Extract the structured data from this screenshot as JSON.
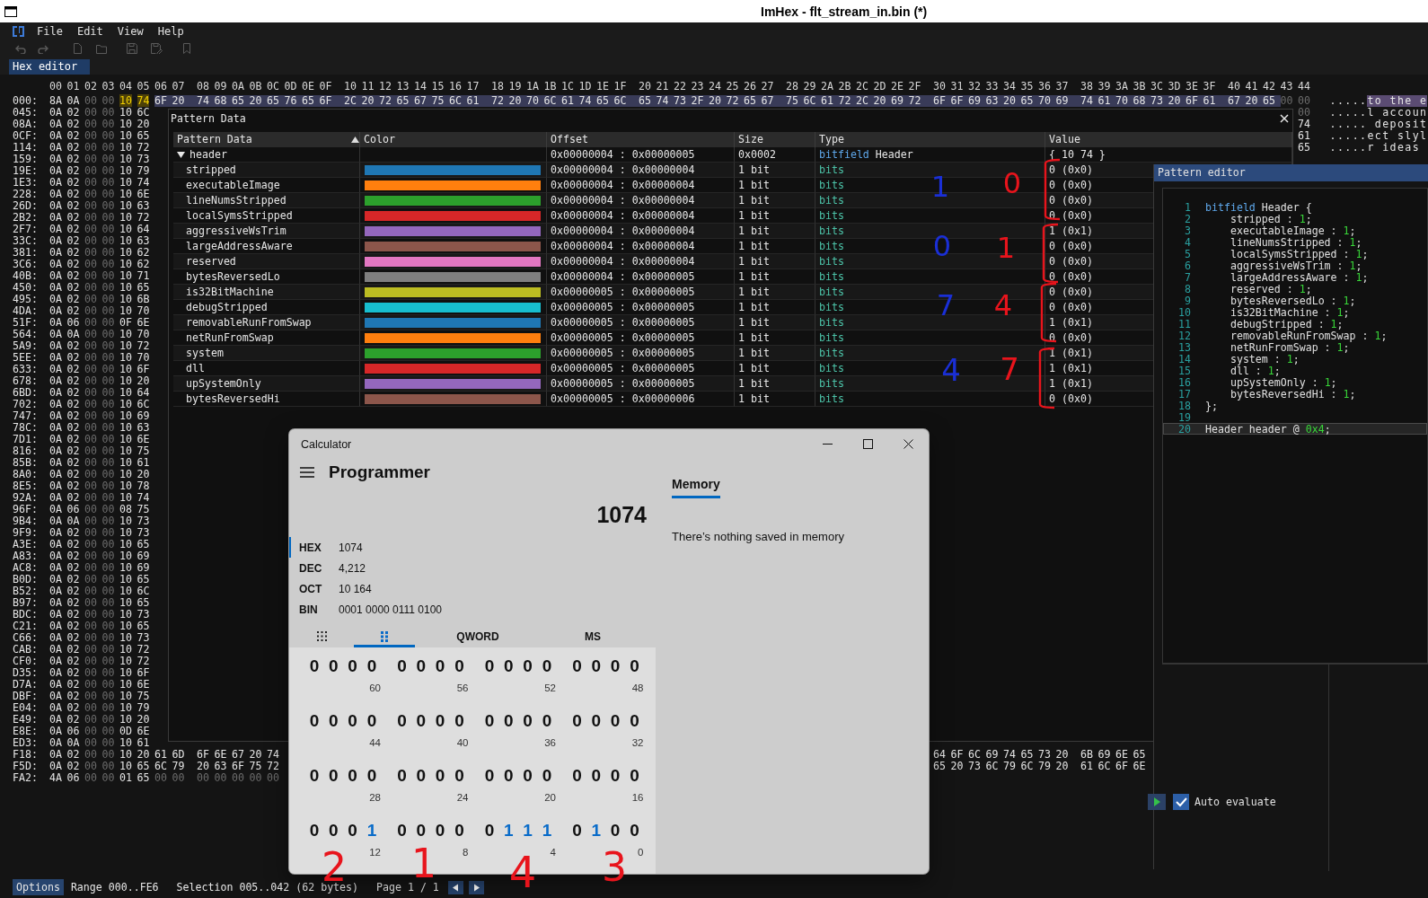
{
  "window": {
    "title": "ImHex - flt_stream_in.bin (*)"
  },
  "menu": [
    {
      "label": "File"
    },
    {
      "label": "Edit"
    },
    {
      "label": "View"
    },
    {
      "label": "Help"
    }
  ],
  "toolbar": [
    {
      "kind": "undo",
      "disabled": true
    },
    {
      "kind": "redo",
      "disabled": true
    },
    {
      "kind": "new-file",
      "disabled": true
    },
    {
      "kind": "open",
      "disabled": true
    },
    {
      "kind": "save",
      "disabled": true
    },
    {
      "kind": "save-as",
      "disabled": true
    },
    {
      "kind": "bookmark",
      "disabled": true
    }
  ],
  "tabs": [
    {
      "label": "Hex editor",
      "selected": true
    }
  ],
  "hex_view": {
    "columns": [
      "00",
      "01",
      "02",
      "03",
      "04",
      "05",
      "06",
      "07",
      "08",
      "09",
      "0A",
      "0B",
      "0C",
      "0D",
      "0E",
      "0F",
      "10",
      "11",
      "12",
      "13",
      "14",
      "15",
      "16",
      "17",
      "18",
      "19",
      "1A",
      "1B",
      "1C",
      "1D",
      "1E",
      "1F",
      "20",
      "21",
      "22",
      "23",
      "24",
      "25",
      "26",
      "27",
      "28",
      "29",
      "2A",
      "2B",
      "2C",
      "2D",
      "2E",
      "2F",
      "30",
      "31",
      "32",
      "33",
      "34",
      "35",
      "36",
      "37",
      "38",
      "39",
      "3A",
      "3B",
      "3C",
      "3D",
      "3E",
      "3F",
      "40",
      "41",
      "42",
      "43",
      "44"
    ],
    "rows": [
      {
        "offset": "000:",
        "bytes": [
          "8A",
          "0A",
          "00",
          "00"
        ],
        "pattern_bytes": [
          "10",
          "74"
        ],
        "selected_bytes": [
          "6F",
          "20",
          "74",
          "68",
          "65",
          "20",
          "65",
          "76",
          "65",
          "6F",
          "2C",
          "20",
          "72",
          "65",
          "67",
          "75",
          "6C",
          "61",
          "72",
          "20",
          "70",
          "6C",
          "61",
          "74",
          "65",
          "6C",
          "65",
          "74",
          "73",
          "2F",
          "20",
          "72",
          "65",
          "67",
          "75",
          "6C",
          "61",
          "72",
          "2C",
          "20",
          "69",
          "72",
          "6F",
          "6F",
          "69",
          "63",
          "20",
          "65",
          "70",
          "69",
          "74",
          "61",
          "70",
          "68",
          "73",
          "20",
          "6F",
          "61",
          "67",
          "20",
          "65"
        ],
        "end_bytes": [
          "00",
          "00"
        ],
        "ascii": ".....",
        "ascii_selected": "to the e"
      },
      {
        "offset": "045:",
        "bytes": [
          "0A",
          "02",
          "00",
          "00",
          "10",
          "6C"
        ],
        "end_bytes": [
          "00"
        ],
        "ascii": ".....l accoun"
      },
      {
        "offset": "08A:",
        "bytes": [
          "0A",
          "02",
          "00",
          "00",
          "10",
          "20"
        ],
        "end_bytes": [
          "74"
        ],
        "ascii": "..... deposit"
      },
      {
        "offset": "0CF:",
        "bytes": [
          "0A",
          "02",
          "00",
          "00",
          "10",
          "65"
        ],
        "end_bytes": [
          "61"
        ],
        "ascii": ".....ect slyl"
      },
      {
        "offset": "114:",
        "bytes": [
          "0A",
          "02",
          "00",
          "00",
          "10",
          "72"
        ],
        "end_bytes": [
          "65"
        ],
        "ascii": ".....r ideas"
      },
      {
        "offset": "159:",
        "bytes": [
          "0A",
          "02",
          "00",
          "00",
          "10",
          "73"
        ]
      },
      {
        "offset": "19E:",
        "bytes": [
          "0A",
          "02",
          "00",
          "00",
          "10",
          "79"
        ]
      },
      {
        "offset": "1E3:",
        "bytes": [
          "0A",
          "02",
          "00",
          "00",
          "10",
          "74"
        ]
      },
      {
        "offset": "228:",
        "bytes": [
          "0A",
          "02",
          "00",
          "00",
          "10",
          "6E"
        ]
      },
      {
        "offset": "26D:",
        "bytes": [
          "0A",
          "02",
          "00",
          "00",
          "10",
          "63"
        ]
      },
      {
        "offset": "2B2:",
        "bytes": [
          "0A",
          "02",
          "00",
          "00",
          "10",
          "72"
        ]
      },
      {
        "offset": "2F7:",
        "bytes": [
          "0A",
          "02",
          "00",
          "00",
          "10",
          "64"
        ]
      },
      {
        "offset": "33C:",
        "bytes": [
          "0A",
          "02",
          "00",
          "00",
          "10",
          "63"
        ]
      },
      {
        "offset": "381:",
        "bytes": [
          "0A",
          "02",
          "00",
          "00",
          "10",
          "62"
        ]
      },
      {
        "offset": "3C6:",
        "bytes": [
          "0A",
          "02",
          "00",
          "00",
          "10",
          "62"
        ]
      },
      {
        "offset": "40B:",
        "bytes": [
          "0A",
          "02",
          "00",
          "00",
          "10",
          "71"
        ]
      },
      {
        "offset": "450:",
        "bytes": [
          "0A",
          "02",
          "00",
          "00",
          "10",
          "65"
        ]
      },
      {
        "offset": "495:",
        "bytes": [
          "0A",
          "02",
          "00",
          "00",
          "10",
          "6B"
        ]
      },
      {
        "offset": "4DA:",
        "bytes": [
          "0A",
          "02",
          "00",
          "00",
          "10",
          "70"
        ]
      },
      {
        "offset": "51F:",
        "bytes": [
          "0A",
          "06",
          "00",
          "00",
          "0F",
          "6E"
        ]
      },
      {
        "offset": "564:",
        "bytes": [
          "0A",
          "0A",
          "00",
          "00",
          "10",
          "70"
        ]
      },
      {
        "offset": "5A9:",
        "bytes": [
          "0A",
          "02",
          "00",
          "00",
          "10",
          "72"
        ]
      },
      {
        "offset": "5EE:",
        "bytes": [
          "0A",
          "02",
          "00",
          "00",
          "10",
          "70"
        ]
      },
      {
        "offset": "633:",
        "bytes": [
          "0A",
          "02",
          "00",
          "00",
          "10",
          "6F"
        ]
      },
      {
        "offset": "678:",
        "bytes": [
          "0A",
          "02",
          "00",
          "00",
          "10",
          "20"
        ]
      },
      {
        "offset": "6BD:",
        "bytes": [
          "0A",
          "02",
          "00",
          "00",
          "10",
          "64"
        ]
      },
      {
        "offset": "702:",
        "bytes": [
          "0A",
          "02",
          "00",
          "00",
          "10",
          "6C"
        ]
      },
      {
        "offset": "747:",
        "bytes": [
          "0A",
          "02",
          "00",
          "00",
          "10",
          "69"
        ]
      },
      {
        "offset": "78C:",
        "bytes": [
          "0A",
          "02",
          "00",
          "00",
          "10",
          "63"
        ]
      },
      {
        "offset": "7D1:",
        "bytes": [
          "0A",
          "02",
          "00",
          "00",
          "10",
          "6E"
        ]
      },
      {
        "offset": "816:",
        "bytes": [
          "0A",
          "02",
          "00",
          "00",
          "10",
          "75"
        ]
      },
      {
        "offset": "85B:",
        "bytes": [
          "0A",
          "02",
          "00",
          "00",
          "10",
          "61"
        ]
      },
      {
        "offset": "8A0:",
        "bytes": [
          "0A",
          "02",
          "00",
          "00",
          "10",
          "20"
        ]
      },
      {
        "offset": "8E5:",
        "bytes": [
          "0A",
          "02",
          "00",
          "00",
          "10",
          "78"
        ]
      },
      {
        "offset": "92A:",
        "bytes": [
          "0A",
          "02",
          "00",
          "00",
          "10",
          "74"
        ]
      },
      {
        "offset": "96F:",
        "bytes": [
          "0A",
          "06",
          "00",
          "00",
          "08",
          "75"
        ]
      },
      {
        "offset": "9B4:",
        "bytes": [
          "0A",
          "0A",
          "00",
          "00",
          "10",
          "73"
        ]
      },
      {
        "offset": "9F9:",
        "bytes": [
          "0A",
          "02",
          "00",
          "00",
          "10",
          "73"
        ]
      },
      {
        "offset": "A3E:",
        "bytes": [
          "0A",
          "02",
          "00",
          "00",
          "10",
          "65"
        ]
      },
      {
        "offset": "A83:",
        "bytes": [
          "0A",
          "02",
          "00",
          "00",
          "10",
          "69"
        ]
      },
      {
        "offset": "AC8:",
        "bytes": [
          "0A",
          "02",
          "00",
          "00",
          "10",
          "69"
        ]
      },
      {
        "offset": "B0D:",
        "bytes": [
          "0A",
          "02",
          "00",
          "00",
          "10",
          "65"
        ]
      },
      {
        "offset": "B52:",
        "bytes": [
          "0A",
          "02",
          "00",
          "00",
          "10",
          "6C"
        ]
      },
      {
        "offset": "B97:",
        "bytes": [
          "0A",
          "02",
          "00",
          "00",
          "10",
          "65"
        ]
      },
      {
        "offset": "BDC:",
        "bytes": [
          "0A",
          "02",
          "00",
          "00",
          "10",
          "73"
        ]
      },
      {
        "offset": "C21:",
        "bytes": [
          "0A",
          "02",
          "00",
          "00",
          "10",
          "65"
        ]
      },
      {
        "offset": "C66:",
        "bytes": [
          "0A",
          "02",
          "00",
          "00",
          "10",
          "73"
        ]
      },
      {
        "offset": "CAB:",
        "bytes": [
          "0A",
          "02",
          "00",
          "00",
          "10",
          "72"
        ]
      },
      {
        "offset": "CF0:",
        "bytes": [
          "0A",
          "02",
          "00",
          "00",
          "10",
          "72"
        ]
      },
      {
        "offset": "D35:",
        "bytes": [
          "0A",
          "02",
          "00",
          "00",
          "10",
          "6F"
        ]
      },
      {
        "offset": "D7A:",
        "bytes": [
          "0A",
          "02",
          "00",
          "00",
          "10",
          "6E"
        ]
      },
      {
        "offset": "DBF:",
        "bytes": [
          "0A",
          "02",
          "00",
          "00",
          "10",
          "75"
        ]
      },
      {
        "offset": "E04:",
        "bytes": [
          "0A",
          "02",
          "00",
          "00",
          "10",
          "79"
        ]
      },
      {
        "offset": "E49:",
        "bytes": [
          "0A",
          "02",
          "00",
          "00",
          "10",
          "20"
        ]
      },
      {
        "offset": "E8E:",
        "bytes": [
          "0A",
          "06",
          "00",
          "00",
          "0D",
          "6E"
        ]
      },
      {
        "offset": "ED3:",
        "bytes": [
          "0A",
          "0A",
          "00",
          "00",
          "10",
          "61"
        ]
      },
      {
        "offset": "F18:",
        "bytes": [
          "0A",
          "02",
          "00",
          "00",
          "10",
          "20",
          "61",
          "6D",
          "6F",
          "6E",
          "67",
          "20",
          "74"
        ],
        "far_bytes": [
          "64",
          "6F",
          "6C",
          "69",
          "74",
          "65",
          "73",
          "20",
          "6B",
          "69",
          "6E",
          "65"
        ]
      },
      {
        "offset": "F5D:",
        "bytes": [
          "0A",
          "02",
          "00",
          "00",
          "10",
          "65",
          "6C",
          "79",
          "20",
          "63",
          "6F",
          "75",
          "72"
        ],
        "far_bytes": [
          "65",
          "20",
          "73",
          "6C",
          "79",
          "6C",
          "79",
          "20",
          "61",
          "6C",
          "6F",
          "6E"
        ]
      },
      {
        "offset": "FA2:",
        "bytes": [
          "4A",
          "06",
          "00",
          "00",
          "01",
          "65",
          "00",
          "00",
          "00",
          "00",
          "00",
          "00",
          "00"
        ]
      }
    ]
  },
  "pattern_data": {
    "title": "Pattern Data",
    "columns": [
      "Pattern Data",
      "Color",
      "Offset",
      "Size",
      "Type",
      "Value"
    ],
    "rows": [
      {
        "name": "header",
        "expanded": true,
        "offset": "0x00000004 : 0x00000005",
        "size": "0x0002",
        "kind": "bitfield",
        "type_keyword": "bitfield",
        "type": "Header",
        "value": "{ 10 74 }",
        "children": [
          {
            "name": "stripped",
            "color": "#1f77b4",
            "offset": "0x00000004 : 0x00000004",
            "size": "1 bit",
            "kind": "bits",
            "type_keyword": "bits",
            "value": "0 (0x0)"
          },
          {
            "name": "executableImage",
            "color": "#ff7f0e",
            "offset": "0x00000004 : 0x00000004",
            "size": "1 bit",
            "kind": "bits",
            "type_keyword": "bits",
            "value": "0 (0x0)"
          },
          {
            "name": "lineNumsStripped",
            "color": "#2ca02c",
            "offset": "0x00000004 : 0x00000004",
            "size": "1 bit",
            "kind": "bits",
            "type_keyword": "bits",
            "value": "0 (0x0)"
          },
          {
            "name": "localSymsStripped",
            "color": "#d62728",
            "offset": "0x00000004 : 0x00000004",
            "size": "1 bit",
            "kind": "bits",
            "type_keyword": "bits",
            "value": "0 (0x0)"
          },
          {
            "name": "aggressiveWsTrim",
            "color": "#9467bd",
            "offset": "0x00000004 : 0x00000004",
            "size": "1 bit",
            "kind": "bits",
            "type_keyword": "bits",
            "value": "1 (0x1)"
          },
          {
            "name": "largeAddressAware",
            "color": "#8c564b",
            "offset": "0x00000004 : 0x00000004",
            "size": "1 bit",
            "kind": "bits",
            "type_keyword": "bits",
            "value": "0 (0x0)"
          },
          {
            "name": "reserved",
            "color": "#e377c2",
            "offset": "0x00000004 : 0x00000004",
            "size": "1 bit",
            "kind": "bits",
            "type_keyword": "bits",
            "value": "0 (0x0)"
          },
          {
            "name": "bytesReversedLo",
            "color": "#7f7f7f",
            "offset": "0x00000004 : 0x00000005",
            "size": "1 bit",
            "kind": "bits",
            "type_keyword": "bits",
            "value": "0 (0x0)"
          },
          {
            "name": "is32BitMachine",
            "color": "#bcbd22",
            "offset": "0x00000005 : 0x00000005",
            "size": "1 bit",
            "kind": "bits",
            "type_keyword": "bits",
            "value": "0 (0x0)"
          },
          {
            "name": "debugStripped",
            "color": "#17becf",
            "offset": "0x00000005 : 0x00000005",
            "size": "1 bit",
            "kind": "bits",
            "type_keyword": "bits",
            "value": "0 (0x0)"
          },
          {
            "name": "removableRunFromSwap",
            "color": "#1f77b4",
            "offset": "0x00000005 : 0x00000005",
            "size": "1 bit",
            "kind": "bits",
            "type_keyword": "bits",
            "value": "1 (0x1)"
          },
          {
            "name": "netRunFromSwap",
            "color": "#ff7f0e",
            "offset": "0x00000005 : 0x00000005",
            "size": "1 bit",
            "kind": "bits",
            "type_keyword": "bits",
            "value": "0 (0x0)"
          },
          {
            "name": "system",
            "color": "#2ca02c",
            "offset": "0x00000005 : 0x00000005",
            "size": "1 bit",
            "kind": "bits",
            "type_keyword": "bits",
            "value": "1 (0x1)"
          },
          {
            "name": "dll",
            "color": "#d62728",
            "offset": "0x00000005 : 0x00000005",
            "size": "1 bit",
            "kind": "bits",
            "type_keyword": "bits",
            "value": "1 (0x1)"
          },
          {
            "name": "upSystemOnly",
            "color": "#9467bd",
            "offset": "0x00000005 : 0x00000005",
            "size": "1 bit",
            "kind": "bits",
            "type_keyword": "bits",
            "value": "1 (0x1)"
          },
          {
            "name": "bytesReversedHi",
            "color": "#8c564b",
            "offset": "0x00000005 : 0x00000006",
            "size": "1 bit",
            "kind": "bits",
            "type_keyword": "bits",
            "value": "0 (0x0)"
          }
        ]
      }
    ]
  },
  "pattern_editor": {
    "title": "Pattern editor",
    "lines": [
      {
        "number": "1",
        "current": false,
        "tokens": [
          {
            "kind": "keyword",
            "text": "bitfield"
          },
          {
            "kind": "plain",
            "text": " Header {"
          }
        ]
      },
      {
        "number": "2",
        "current": false,
        "tokens": [
          {
            "kind": "plain",
            "text": "    stripped : "
          },
          {
            "kind": "number",
            "text": "1"
          },
          {
            "kind": "plain",
            "text": ";"
          }
        ]
      },
      {
        "number": "3",
        "current": false,
        "tokens": [
          {
            "kind": "plain",
            "text": "    executableImage : "
          },
          {
            "kind": "number",
            "text": "1"
          },
          {
            "kind": "plain",
            "text": ";"
          }
        ]
      },
      {
        "number": "4",
        "current": false,
        "tokens": [
          {
            "kind": "plain",
            "text": "    lineNumsStripped : "
          },
          {
            "kind": "number",
            "text": "1"
          },
          {
            "kind": "plain",
            "text": ";"
          }
        ]
      },
      {
        "number": "5",
        "current": false,
        "tokens": [
          {
            "kind": "plain",
            "text": "    localSymsStripped : "
          },
          {
            "kind": "number",
            "text": "1"
          },
          {
            "kind": "plain",
            "text": ";"
          }
        ]
      },
      {
        "number": "6",
        "current": false,
        "tokens": [
          {
            "kind": "plain",
            "text": "    aggressiveWsTrim : "
          },
          {
            "kind": "number",
            "text": "1"
          },
          {
            "kind": "plain",
            "text": ";"
          }
        ]
      },
      {
        "number": "7",
        "current": false,
        "tokens": [
          {
            "kind": "plain",
            "text": "    largeAddressAware : "
          },
          {
            "kind": "number",
            "text": "1"
          },
          {
            "kind": "plain",
            "text": ";"
          }
        ]
      },
      {
        "number": "8",
        "current": false,
        "tokens": [
          {
            "kind": "plain",
            "text": "    reserved : "
          },
          {
            "kind": "number",
            "text": "1"
          },
          {
            "kind": "plain",
            "text": ";"
          }
        ]
      },
      {
        "number": "9",
        "current": false,
        "tokens": [
          {
            "kind": "plain",
            "text": "    bytesReversedLo : "
          },
          {
            "kind": "number",
            "text": "1"
          },
          {
            "kind": "plain",
            "text": ";"
          }
        ]
      },
      {
        "number": "10",
        "current": false,
        "tokens": [
          {
            "kind": "plain",
            "text": "    is32BitMachine : "
          },
          {
            "kind": "number",
            "text": "1"
          },
          {
            "kind": "plain",
            "text": ";"
          }
        ]
      },
      {
        "number": "11",
        "current": false,
        "tokens": [
          {
            "kind": "plain",
            "text": "    debugStripped : "
          },
          {
            "kind": "number",
            "text": "1"
          },
          {
            "kind": "plain",
            "text": ";"
          }
        ]
      },
      {
        "number": "12",
        "current": false,
        "tokens": [
          {
            "kind": "plain",
            "text": "    removableRunFromSwap : "
          },
          {
            "kind": "number",
            "text": "1"
          },
          {
            "kind": "plain",
            "text": ";"
          }
        ]
      },
      {
        "number": "13",
        "current": false,
        "tokens": [
          {
            "kind": "plain",
            "text": "    netRunFromSwap : "
          },
          {
            "kind": "number",
            "text": "1"
          },
          {
            "kind": "plain",
            "text": ";"
          }
        ]
      },
      {
        "number": "14",
        "current": false,
        "tokens": [
          {
            "kind": "plain",
            "text": "    system : "
          },
          {
            "kind": "number",
            "text": "1"
          },
          {
            "kind": "plain",
            "text": ";"
          }
        ]
      },
      {
        "number": "15",
        "current": false,
        "tokens": [
          {
            "kind": "plain",
            "text": "    dll : "
          },
          {
            "kind": "number",
            "text": "1"
          },
          {
            "kind": "plain",
            "text": ";"
          }
        ]
      },
      {
        "number": "16",
        "current": false,
        "tokens": [
          {
            "kind": "plain",
            "text": "    upSystemOnly : "
          },
          {
            "kind": "number",
            "text": "1"
          },
          {
            "kind": "plain",
            "text": ";"
          }
        ]
      },
      {
        "number": "17",
        "current": false,
        "tokens": [
          {
            "kind": "plain",
            "text": "    bytesReversedHi : "
          },
          {
            "kind": "number",
            "text": "1"
          },
          {
            "kind": "plain",
            "text": ";"
          }
        ]
      },
      {
        "number": "18",
        "current": false,
        "tokens": [
          {
            "kind": "plain",
            "text": "};"
          }
        ]
      },
      {
        "number": "19",
        "current": false
      },
      {
        "number": "20",
        "current": true,
        "tokens": [
          {
            "kind": "plain",
            "text": "Header header @ "
          },
          {
            "kind": "number",
            "text": "0x4"
          },
          {
            "kind": "plain",
            "text": ";"
          }
        ]
      }
    ],
    "auto_evaluate": {
      "label": "Auto evaluate",
      "checked": true
    }
  },
  "calculator": {
    "title": "Calculator",
    "mode": "Programmer",
    "display": "1074",
    "radixes": [
      {
        "label": "HEX",
        "value": "1074",
        "selected": true
      },
      {
        "label": "DEC",
        "value": "4,212",
        "selected": false
      },
      {
        "label": "OCT",
        "value": "10 164",
        "selected": false
      },
      {
        "label": "BIN",
        "value": "0001 0000 0111 0100",
        "selected": false
      }
    ],
    "keypad_tabs": [
      {
        "kind": "keypad",
        "selected": false
      },
      {
        "kind": "bit-toggle",
        "selected": true
      },
      {
        "kind": "text",
        "label": "QWORD",
        "selected": false
      },
      {
        "kind": "text",
        "label": "MS",
        "selected": false
      }
    ],
    "bit_rows": [
      {
        "groups": [
          {
            "bits": [
              "0",
              "0",
              "0",
              "0"
            ],
            "set": [
              false,
              false,
              false,
              false
            ],
            "label": "60"
          },
          {
            "bits": [
              "0",
              "0",
              "0",
              "0"
            ],
            "set": [
              false,
              false,
              false,
              false
            ],
            "label": "56"
          },
          {
            "bits": [
              "0",
              "0",
              "0",
              "0"
            ],
            "set": [
              false,
              false,
              false,
              false
            ],
            "label": "52"
          },
          {
            "bits": [
              "0",
              "0",
              "0",
              "0"
            ],
            "set": [
              false,
              false,
              false,
              false
            ],
            "label": "48"
          }
        ]
      },
      {
        "groups": [
          {
            "bits": [
              "0",
              "0",
              "0",
              "0"
            ],
            "set": [
              false,
              false,
              false,
              false
            ],
            "label": "44"
          },
          {
            "bits": [
              "0",
              "0",
              "0",
              "0"
            ],
            "set": [
              false,
              false,
              false,
              false
            ],
            "label": "40"
          },
          {
            "bits": [
              "0",
              "0",
              "0",
              "0"
            ],
            "set": [
              false,
              false,
              false,
              false
            ],
            "label": "36"
          },
          {
            "bits": [
              "0",
              "0",
              "0",
              "0"
            ],
            "set": [
              false,
              false,
              false,
              false
            ],
            "label": "32"
          }
        ]
      },
      {
        "groups": [
          {
            "bits": [
              "0",
              "0",
              "0",
              "0"
            ],
            "set": [
              false,
              false,
              false,
              false
            ],
            "label": "28"
          },
          {
            "bits": [
              "0",
              "0",
              "0",
              "0"
            ],
            "set": [
              false,
              false,
              false,
              false
            ],
            "label": "24"
          },
          {
            "bits": [
              "0",
              "0",
              "0",
              "0"
            ],
            "set": [
              false,
              false,
              false,
              false
            ],
            "label": "20"
          },
          {
            "bits": [
              "0",
              "0",
              "0",
              "0"
            ],
            "set": [
              false,
              false,
              false,
              false
            ],
            "label": "16"
          }
        ]
      },
      {
        "groups": [
          {
            "bits": [
              "0",
              "0",
              "0",
              "1"
            ],
            "set": [
              false,
              false,
              false,
              true
            ],
            "label": "12"
          },
          {
            "bits": [
              "0",
              "0",
              "0",
              "0"
            ],
            "set": [
              false,
              false,
              false,
              false
            ],
            "label": "8"
          },
          {
            "bits": [
              "0",
              "1",
              "1",
              "1"
            ],
            "set": [
              false,
              true,
              true,
              true
            ],
            "label": "4"
          },
          {
            "bits": [
              "0",
              "1",
              "0",
              "0"
            ],
            "set": [
              false,
              true,
              false,
              false
            ],
            "label": "0"
          }
        ]
      }
    ],
    "memory": {
      "label": "Memory",
      "selected": true,
      "empty_text": "There’s nothing saved in memory"
    }
  },
  "status_bar": {
    "options": "Options",
    "range": "Range 000..FE6",
    "selection": "Selection 005..042 (62 bytes)",
    "page": "Page 1 / 1"
  },
  "annotations": [
    {
      "text": "1",
      "color": "#1a2fd6"
    },
    {
      "text": "0",
      "color": "#e8141c"
    },
    {
      "text": "0",
      "color": "#1a2fd6"
    },
    {
      "text": "1",
      "color": "#e8141c"
    },
    {
      "text": "7",
      "color": "#1a2fd6"
    },
    {
      "text": "4",
      "color": "#e8141c"
    },
    {
      "text": "4",
      "color": "#1a2fd6"
    },
    {
      "text": "7",
      "color": "#e8141c"
    },
    {
      "text": "2",
      "color": "#e8141c"
    },
    {
      "text": "1",
      "color": "#e8141c"
    },
    {
      "text": "4",
      "color": "#e8141c"
    },
    {
      "text": "3",
      "color": "#e8141c"
    }
  ]
}
